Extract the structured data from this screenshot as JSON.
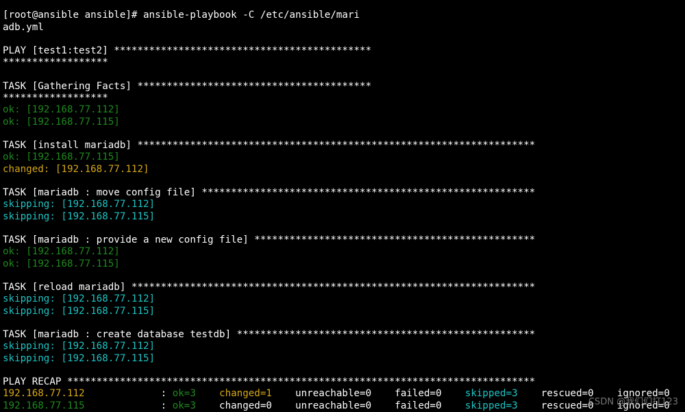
{
  "colors": {
    "background": "#000000",
    "default": "#ffffff",
    "ok": "#1e8a1e",
    "changed": "#d6a818",
    "skipping": "#1ec4c4"
  },
  "terminal": {
    "lines": [
      {
        "name": "prev-output-line",
        "segs": [
          {
            "t": "PLAY RECAP ***************************************************************",
            "c": "white"
          }
        ]
      },
      {
        "name": "command-line-1",
        "segs": [
          {
            "t": "[root@ansible ansible]# ansible-playbook -C /etc/ansible/mari",
            "c": "white"
          }
        ]
      },
      {
        "name": "command-line-2",
        "segs": [
          {
            "t": "adb.yml",
            "c": "white"
          }
        ]
      },
      {
        "name": "blank-line",
        "segs": []
      },
      {
        "name": "play-header",
        "segs": [
          {
            "t": "PLAY [test1:test2] ********************************************",
            "c": "white"
          }
        ]
      },
      {
        "name": "play-header-wrap",
        "segs": [
          {
            "t": "******************",
            "c": "white"
          }
        ]
      },
      {
        "name": "blank-line",
        "segs": []
      },
      {
        "name": "task-header-gathering-facts",
        "segs": [
          {
            "t": "TASK [Gathering Facts] ****************************************",
            "c": "white"
          }
        ]
      },
      {
        "name": "task-header-wrap",
        "segs": [
          {
            "t": "******************",
            "c": "white"
          }
        ]
      },
      {
        "name": "result-ok",
        "segs": [
          {
            "t": "ok: [192.168.77.112]",
            "c": "green"
          }
        ]
      },
      {
        "name": "result-ok",
        "segs": [
          {
            "t": "ok: [192.168.77.115]",
            "c": "green"
          }
        ]
      },
      {
        "name": "blank-line",
        "segs": []
      },
      {
        "name": "task-header-install-mariadb",
        "segs": [
          {
            "t": "TASK [install mariadb] ********************************************************************",
            "c": "white"
          }
        ]
      },
      {
        "name": "result-ok",
        "segs": [
          {
            "t": "ok: [192.168.77.115]",
            "c": "green"
          }
        ]
      },
      {
        "name": "result-changed",
        "segs": [
          {
            "t": "changed: [192.168.77.112]",
            "c": "yellow"
          }
        ]
      },
      {
        "name": "blank-line",
        "segs": []
      },
      {
        "name": "task-header-move-config",
        "segs": [
          {
            "t": "TASK [mariadb : move config file] *********************************************************",
            "c": "white"
          }
        ]
      },
      {
        "name": "result-skipping",
        "segs": [
          {
            "t": "skipping: [192.168.77.112]",
            "c": "cyan"
          }
        ]
      },
      {
        "name": "result-skipping",
        "segs": [
          {
            "t": "skipping: [192.168.77.115]",
            "c": "cyan"
          }
        ]
      },
      {
        "name": "blank-line",
        "segs": []
      },
      {
        "name": "task-header-provide-config",
        "segs": [
          {
            "t": "TASK [mariadb : provide a new config file] ************************************************",
            "c": "white"
          }
        ]
      },
      {
        "name": "result-ok",
        "segs": [
          {
            "t": "ok: [192.168.77.112]",
            "c": "green"
          }
        ]
      },
      {
        "name": "result-ok",
        "segs": [
          {
            "t": "ok: [192.168.77.115]",
            "c": "green"
          }
        ]
      },
      {
        "name": "blank-line",
        "segs": []
      },
      {
        "name": "task-header-reload-mariadb",
        "segs": [
          {
            "t": "TASK [reload mariadb] *********************************************************************",
            "c": "white"
          }
        ]
      },
      {
        "name": "result-skipping",
        "segs": [
          {
            "t": "skipping: [192.168.77.112]",
            "c": "cyan"
          }
        ]
      },
      {
        "name": "result-skipping",
        "segs": [
          {
            "t": "skipping: [192.168.77.115]",
            "c": "cyan"
          }
        ]
      },
      {
        "name": "blank-line",
        "segs": []
      },
      {
        "name": "task-header-create-database",
        "segs": [
          {
            "t": "TASK [mariadb : create database testdb] ***************************************************",
            "c": "white"
          }
        ]
      },
      {
        "name": "result-skipping",
        "segs": [
          {
            "t": "skipping: [192.168.77.112]",
            "c": "cyan"
          }
        ]
      },
      {
        "name": "result-skipping",
        "segs": [
          {
            "t": "skipping: [192.168.77.115]",
            "c": "cyan"
          }
        ]
      },
      {
        "name": "blank-line",
        "segs": []
      },
      {
        "name": "play-recap-header",
        "segs": [
          {
            "t": "PLAY RECAP ********************************************************************************",
            "c": "white"
          }
        ]
      },
      {
        "name": "recap-host-112",
        "segs": [
          {
            "t": "192.168.77.112",
            "c": "yellow"
          },
          {
            "t": "             : ",
            "c": "white"
          },
          {
            "t": "ok=3",
            "c": "green"
          },
          {
            "t": "    ",
            "c": "white"
          },
          {
            "t": "changed=1",
            "c": "yellow"
          },
          {
            "t": "    unreachable=0    failed=0    ",
            "c": "white"
          },
          {
            "t": "skipped=3",
            "c": "cyan"
          },
          {
            "t": "    rescued=0    ignored=0",
            "c": "white"
          }
        ]
      },
      {
        "name": "recap-host-115",
        "segs": [
          {
            "t": "192.168.77.115",
            "c": "green"
          },
          {
            "t": "             : ",
            "c": "white"
          },
          {
            "t": "ok=3",
            "c": "green"
          },
          {
            "t": "    changed=0    unreachable=0    failed=0    ",
            "c": "white"
          },
          {
            "t": "skipped=3",
            "c": "cyan"
          },
          {
            "t": "    rescued=0    ignored=0",
            "c": "white"
          }
        ]
      }
    ]
  },
  "watermark": "CSDN @我们们打123"
}
